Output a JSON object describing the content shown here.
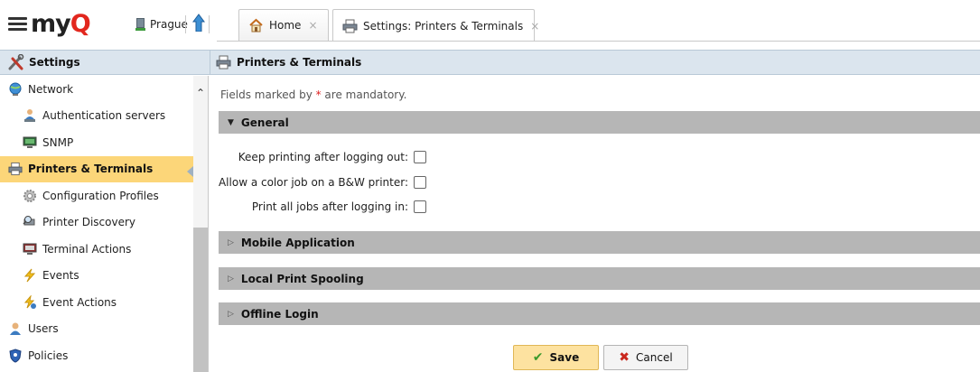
{
  "app": {
    "logo_text": "myQ",
    "server_name": "Prague"
  },
  "tabs": [
    {
      "label": "Home",
      "close": "×",
      "icon": "home-icon"
    },
    {
      "label": "Settings: Printers & Terminals",
      "close": "×",
      "icon": "printer-icon"
    }
  ],
  "sidebar": {
    "header": "Settings",
    "items": [
      {
        "label": "Network",
        "icon": "globe-icon"
      },
      {
        "label": "Authentication servers",
        "icon": "user-server-icon"
      },
      {
        "label": "SNMP",
        "icon": "monitor-icon"
      },
      {
        "label": "Printers & Terminals",
        "icon": "printer-icon",
        "selected": true
      },
      {
        "label": "Configuration Profiles",
        "icon": "gear-icon"
      },
      {
        "label": "Printer Discovery",
        "icon": "printer-search-icon"
      },
      {
        "label": "Terminal Actions",
        "icon": "terminal-icon"
      },
      {
        "label": "Events",
        "icon": "lightning-icon"
      },
      {
        "label": "Event Actions",
        "icon": "event-action-icon"
      },
      {
        "label": "Users",
        "icon": "user-icon"
      },
      {
        "label": "Policies",
        "icon": "shield-icon"
      }
    ]
  },
  "main": {
    "header": "Printers & Terminals",
    "mandatory_note_prefix": "Fields marked by ",
    "mandatory_note_star": "*",
    "mandatory_note_suffix": " are mandatory.",
    "sections": [
      {
        "title": "General",
        "expanded": true
      },
      {
        "title": "Mobile Application",
        "expanded": false
      },
      {
        "title": "Local Print Spooling",
        "expanded": false
      },
      {
        "title": "Offline Login",
        "expanded": false
      }
    ],
    "fields": [
      {
        "label": "Keep printing after logging out:",
        "checked": false
      },
      {
        "label": "Allow a color job on a B&W printer:",
        "checked": false
      },
      {
        "label": "Print all jobs after logging in:",
        "checked": false
      }
    ],
    "save_label": "Save",
    "cancel_label": "Cancel"
  },
  "colors": {
    "selected_bg": "#fcd679",
    "header_bg": "#dbe5ee",
    "section_bg": "#b6b6b6",
    "save_bg": "#fde2a0",
    "logo_accent": "#e2271e"
  }
}
